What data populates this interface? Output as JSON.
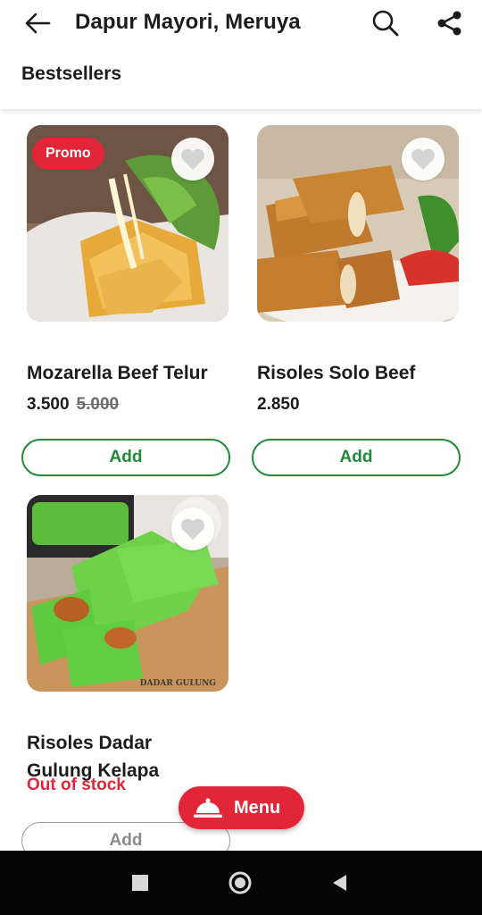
{
  "header": {
    "title": "Dapur Mayori, Meruya",
    "back_icon": "arrow-left-icon",
    "search_icon": "search-icon",
    "share_icon": "share-icon"
  },
  "section": {
    "title": "Bestsellers"
  },
  "products": [
    {
      "name": "Mozarella Beef Telur",
      "badge": "Promo",
      "price": "3.500",
      "old_price": "5.000",
      "button": "Add",
      "favorite_icon": "heart-icon"
    },
    {
      "name": "Risoles Solo Beef",
      "price": "2.850",
      "button": "Add",
      "favorite_icon": "heart-icon"
    },
    {
      "name": "Risoles Dadar Gulung Kelapa",
      "status": "Out of stock",
      "button": "Add",
      "image_caption": "DADAR GULUNG",
      "favorite_icon": "heart-icon"
    }
  ],
  "fab": {
    "label": "Menu",
    "icon": "cloche-icon"
  },
  "system_nav": {
    "recents_icon": "square-icon",
    "home_icon": "circle-icon",
    "back_icon": "triangle-back-icon"
  },
  "colors": {
    "accent_red": "#e32637",
    "add_green": "#1f8a3a",
    "navbar": "#050505"
  }
}
